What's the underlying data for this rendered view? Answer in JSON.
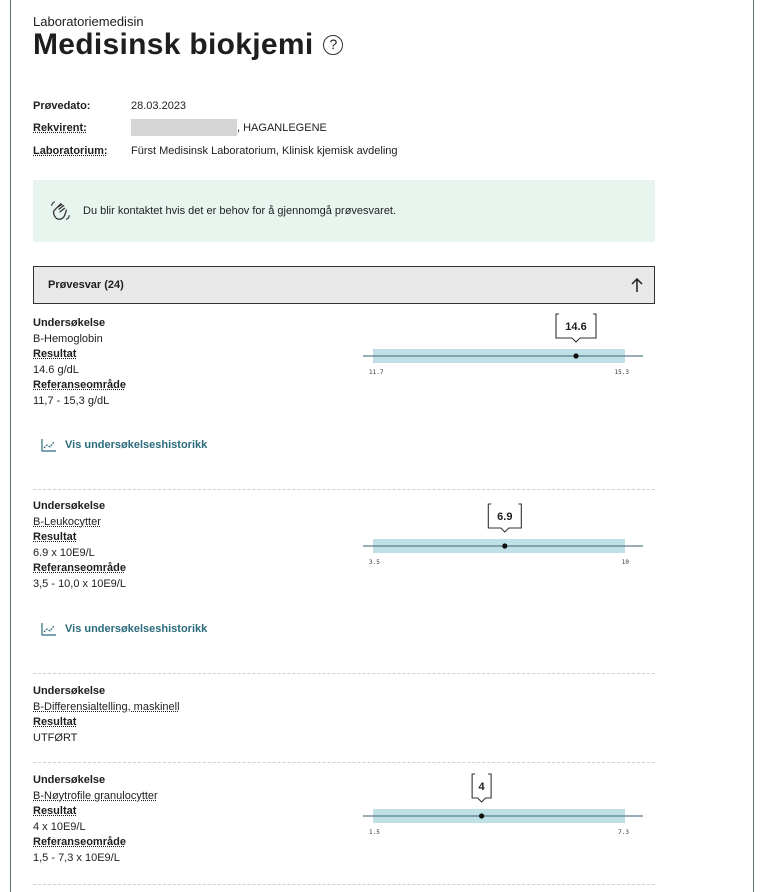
{
  "header": {
    "subtitle": "Laboratoriemedisin",
    "title": "Medisinsk biokjemi",
    "help_glyph": "?"
  },
  "meta": {
    "date_label": "Prøvedato:",
    "date_value": "28.03.2023",
    "requester_label": "Rekvirent:",
    "requester_value": ", HAGANLEGENE",
    "lab_label": "Laboratorium:",
    "lab_value": "Fürst Medisinsk Laboratorium, Klinisk kjemisk avdeling"
  },
  "alert": {
    "text": "Du blir kontaktet hvis det er behov for å gjennomgå prøvesvaret.",
    "icon": "waving-hand-icon"
  },
  "accordion": {
    "label": "Prøvesvar (24)",
    "icon": "arrow-up-icon"
  },
  "labels": {
    "test": "Undersøkelse",
    "result": "Resultat",
    "reference": "Referanseområde",
    "history": "Vis undersøkelseshistorikk"
  },
  "results": [
    {
      "test": "B-Hemoglobin",
      "result": "14.6 g/dL",
      "reference": "11,7 - 15,3 g/dL"
    },
    {
      "test": "B-Leukocytter",
      "result": "6.9 x 10E9/L",
      "reference": "3,5 - 10,0 x 10E9/L"
    },
    {
      "test": "B-Differensialtelling, maskinell",
      "result": "UTFØRT"
    },
    {
      "test": "B-Nøytrofile granulocytter",
      "result": "4 x 10E9/L",
      "reference": "1,5 - 7,3 x 10E9/L"
    }
  ],
  "chart_data": [
    {
      "type": "scatter",
      "value": 14.6,
      "value_label": "14.6",
      "range_low": 11.7,
      "range_high": 15.3,
      "low_label": "11.7",
      "high_label": "15.3"
    },
    {
      "type": "scatter",
      "value": 6.9,
      "value_label": "6.9",
      "range_low": 3.5,
      "range_high": 10,
      "low_label": "3.5",
      "high_label": "10"
    },
    {
      "type": "scatter",
      "value": 4,
      "value_label": "4",
      "range_low": 1.5,
      "range_high": 7.3,
      "low_label": "1.5",
      "high_label": "7.3"
    }
  ],
  "colors": {
    "band": "#bfe1e6",
    "line": "#5b7c8a",
    "alert_bg": "#e8f5ef",
    "link": "#2a6b7c"
  }
}
